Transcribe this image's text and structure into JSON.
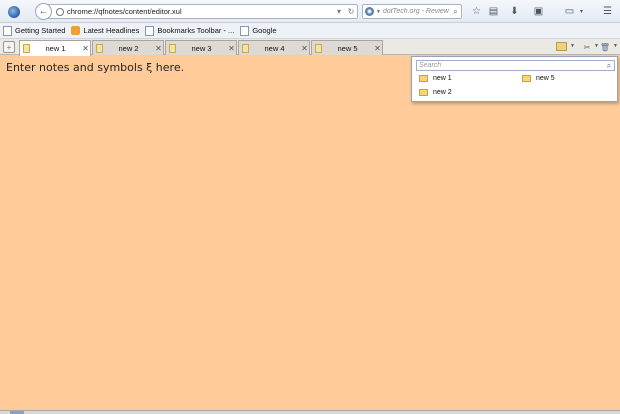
{
  "toolbar": {
    "url": "chrome://qfnotes/content/editor.xul",
    "search_placeholder": "dotTech.org - Review",
    "icons": [
      "firefox-logo",
      "back-arrow",
      "globe",
      "dropdown",
      "reload",
      "search-engine",
      "magnifier",
      "star",
      "clipboard",
      "download",
      "addon",
      "screen",
      "menu"
    ]
  },
  "bookmarks": [
    {
      "label": "Getting Started",
      "icon": "page"
    },
    {
      "label": "Latest Headlines",
      "icon": "rss"
    },
    {
      "label": "Bookmarks Toolbar - ...",
      "icon": "page"
    },
    {
      "label": "Google",
      "icon": "page"
    }
  ],
  "tabs": [
    {
      "label": "new 1",
      "active": true
    },
    {
      "label": "new 2",
      "active": false
    },
    {
      "label": "new 3",
      "active": false
    },
    {
      "label": "new 4",
      "active": false
    },
    {
      "label": "new 5",
      "active": false
    }
  ],
  "editor": {
    "text": "Enter notes and symbols ξ here.",
    "background": "#ffcc99"
  },
  "panel": {
    "search_placeholder": "Search",
    "items": [
      "new 1",
      "new 5",
      "new 2"
    ]
  }
}
